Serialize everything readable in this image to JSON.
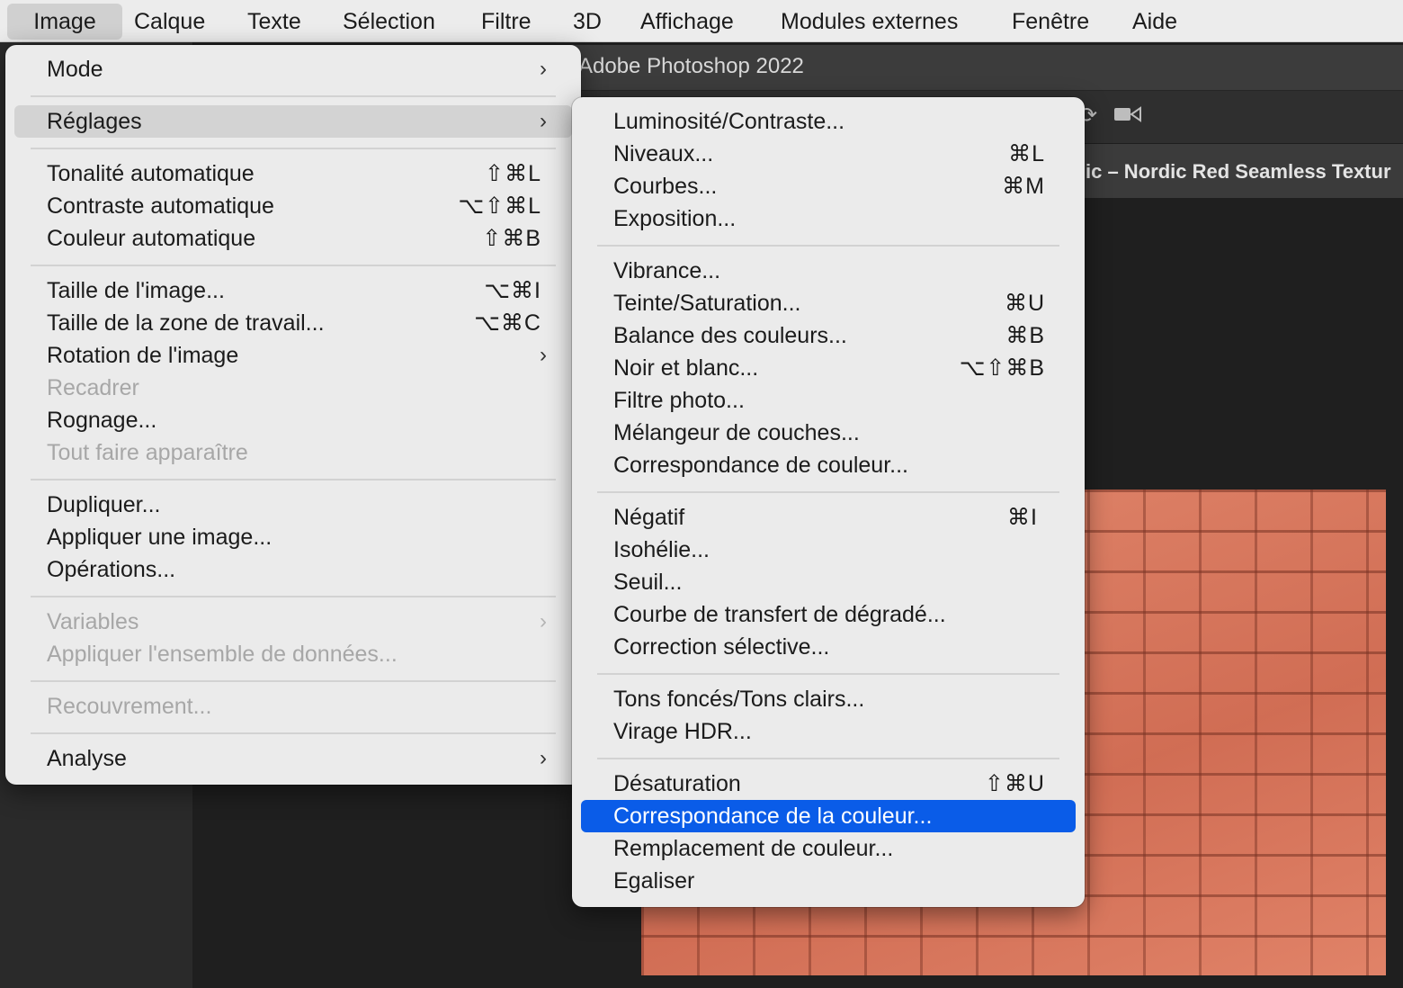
{
  "menubar": {
    "items": [
      "Image",
      "Calque",
      "Texte",
      "Sélection",
      "Filtre",
      "3D",
      "Affichage",
      "Modules externes",
      "Fenêtre",
      "Aide"
    ]
  },
  "photoshop": {
    "app_title": "Adobe Photoshop 2022",
    "doc_tab": "ic – Nordic Red Seamless Textur"
  },
  "image_menu": {
    "mode": "Mode",
    "reglages": "Réglages",
    "tonalite_auto": "Tonalité automatique",
    "tonalite_auto_sc": "⇧⌘L",
    "contraste_auto": "Contraste automatique",
    "contraste_auto_sc": "⌥⇧⌘L",
    "couleur_auto": "Couleur automatique",
    "couleur_auto_sc": "⇧⌘B",
    "taille_image": "Taille de l'image...",
    "taille_image_sc": "⌥⌘I",
    "taille_zone": "Taille de la zone de travail...",
    "taille_zone_sc": "⌥⌘C",
    "rotation": "Rotation de l'image",
    "recadrer": "Recadrer",
    "rognage": "Rognage...",
    "tout_faire": "Tout faire apparaître",
    "dupliquer": "Dupliquer...",
    "appliquer_image": "Appliquer une image...",
    "operations": "Opérations...",
    "variables": "Variables",
    "appliquer_ensemble": "Appliquer l'ensemble de données...",
    "recouvrement": "Recouvrement...",
    "analyse": "Analyse"
  },
  "reglages_menu": {
    "luminosite": "Luminosité/Contraste...",
    "niveaux": "Niveaux...",
    "niveaux_sc": "⌘L",
    "courbes": "Courbes...",
    "courbes_sc": "⌘M",
    "exposition": "Exposition...",
    "vibrance": "Vibrance...",
    "teinte": "Teinte/Saturation...",
    "teinte_sc": "⌘U",
    "balance": "Balance des couleurs...",
    "balance_sc": "⌘B",
    "noir_blanc": "Noir et blanc...",
    "noir_blanc_sc": "⌥⇧⌘B",
    "filtre_photo": "Filtre photo...",
    "melangeur": "Mélangeur de couches...",
    "correspondance_couleur": "Correspondance de couleur...",
    "negatif": "Négatif",
    "negatif_sc": "⌘I",
    "isohelie": "Isohélie...",
    "seuil": "Seuil...",
    "courbe_transfert": "Courbe de transfert de dégradé...",
    "correction_selective": "Correction sélective...",
    "tons": "Tons foncés/Tons clairs...",
    "virage_hdr": "Virage HDR...",
    "desaturation": "Désaturation",
    "desaturation_sc": "⇧⌘U",
    "correspondance_la_couleur": "Correspondance de la couleur...",
    "remplacement": "Remplacement de couleur...",
    "egaliser": "Egaliser"
  },
  "colors": {
    "highlight_blue": "#0a5ce8",
    "menu_bg": "#ebebeb"
  }
}
